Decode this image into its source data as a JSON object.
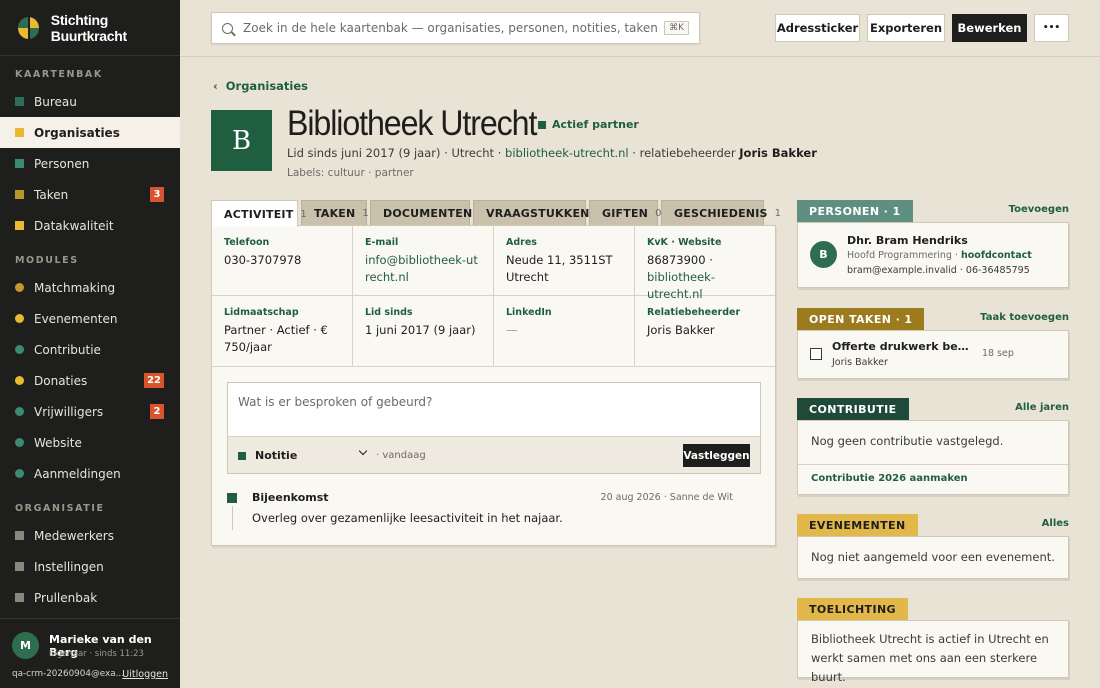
{
  "app": {
    "name": "Stichting Buurtkracht"
  },
  "sidebar": {
    "sections": [
      {
        "title": "KAARTENBAK",
        "items": [
          {
            "label": "Bureau",
            "color": "#2e6e5a",
            "shape": "square"
          },
          {
            "label": "Organisaties",
            "color": "#e8b931",
            "shape": "square",
            "active": true
          },
          {
            "label": "Personen",
            "color": "#3b8a72",
            "shape": "square"
          },
          {
            "label": "Taken",
            "color": "#b8962b",
            "shape": "square",
            "badge": "3"
          },
          {
            "label": "Datakwaliteit",
            "color": "#e8b931",
            "shape": "square"
          }
        ]
      },
      {
        "title": "MODULES",
        "items": [
          {
            "label": "Matchmaking",
            "color": "#c39a2a",
            "shape": "dot"
          },
          {
            "label": "Evenementen",
            "color": "#e8b931",
            "shape": "dot"
          },
          {
            "label": "Contributie",
            "color": "#3b8a72",
            "shape": "dot"
          },
          {
            "label": "Donaties",
            "color": "#e8b931",
            "shape": "dot",
            "badge": "22"
          },
          {
            "label": "Vrijwilligers",
            "color": "#3b8a72",
            "shape": "dot",
            "badge": "2"
          },
          {
            "label": "Website",
            "color": "#3b8a72",
            "shape": "dot"
          },
          {
            "label": "Aanmeldingen",
            "color": "#3b8a72",
            "shape": "dot"
          }
        ]
      },
      {
        "title": "ORGANISATIE",
        "items": [
          {
            "label": "Medewerkers",
            "color": "#8a867d",
            "shape": "square"
          },
          {
            "label": "Instellingen",
            "color": "#8a867d",
            "shape": "square"
          },
          {
            "label": "Prullenbak",
            "color": "#8a867d",
            "shape": "square"
          }
        ]
      }
    ],
    "user": {
      "initial": "M",
      "name": "Marieke van den Berg",
      "role": "Eigenaar · sinds 11:23",
      "email": "qa-crm-20260904@exa...",
      "logout": "Uitloggen"
    }
  },
  "topbar": {
    "search_placeholder": "Zoek in de hele kaartenbak — organisaties, personen, notities, taken, documenten",
    "search_shortcut": "⌘K",
    "buttons": {
      "address": "Adressticker",
      "export": "Exporteren",
      "edit": "Bewerken",
      "more": "•••"
    }
  },
  "header": {
    "breadcrumb": "Organisaties",
    "logo_letter": "B",
    "title": "Bibliotheek Utrecht",
    "status": "Actief partner",
    "meta_prefix": "Lid sinds juni 2017 (9 jaar) · Utrecht · ",
    "meta_site": "bibliotheek-utrecht.nl",
    "meta_manager_label": " · relatiebeheerder ",
    "meta_manager": "Joris Bakker",
    "labels": "Labels: cultuur · partner"
  },
  "tabs": [
    {
      "label": "ACTIVITEIT",
      "count": "1",
      "active": true
    },
    {
      "label": "TAKEN",
      "count": "1"
    },
    {
      "label": "DOCUMENTEN",
      "count": "0"
    },
    {
      "label": "VRAAGSTUKKEN",
      "count": "0"
    },
    {
      "label": "GIFTEN",
      "count": "0"
    },
    {
      "label": "GESCHIEDENIS",
      "count": "1"
    }
  ],
  "details": {
    "phone": {
      "label": "Telefoon",
      "value": "030-3707978"
    },
    "email": {
      "label": "E-mail",
      "value": "info@bibliotheek-utrecht.nl"
    },
    "address": {
      "label": "Adres",
      "value": "Neude 11, 3511ST Utrecht"
    },
    "kvk": {
      "label": "KvK · Website",
      "value": "86873900 ·",
      "site": "bibliotheek-utrecht.nl"
    },
    "membership": {
      "label": "Lidmaatschap",
      "value": "Partner · Actief · € 750/jaar"
    },
    "since": {
      "label": "Lid sinds",
      "value": "1 juni 2017 (9 jaar)"
    },
    "linkedin": {
      "label": "LinkedIn",
      "value": "—"
    },
    "manager": {
      "label": "Relatiebeheerder",
      "value": "Joris Bakker"
    }
  },
  "note": {
    "placeholder": "Wat is er besproken of gebeurd?",
    "type": "Notitie",
    "date": "· vandaag",
    "submit": "Vastleggen"
  },
  "timeline": [
    {
      "title": "Bijeenkomst",
      "meta": "20 aug 2026 · Sanne de Wit",
      "body": "Overleg over gezamenlijke leesactiviteit in het najaar."
    }
  ],
  "right": {
    "persons": {
      "title": "PERSONEN · 1",
      "link": "Toevoegen",
      "color": "#5f8f80",
      "person": {
        "initial": "B",
        "name": "Dhr. Bram Hendriks",
        "role": "Hoofd Programmering · ",
        "role_tag": "hoofdcontact",
        "contact": "bram@example.invalid · 06-36485795"
      }
    },
    "tasks": {
      "title": "OPEN TAKEN · 1",
      "link": "Taak toevoegen",
      "color": "#9c7a1e",
      "task": {
        "title": "Offerte drukwerk beoordelen",
        "who": "Joris Bakker",
        "date": "18 sep"
      }
    },
    "contribution": {
      "title": "CONTRIBUTIE",
      "link": "Alle jaren",
      "color": "#1f4a3a",
      "text": "Nog geen contributie vastgelegd.",
      "action": "Contributie 2026 aanmaken"
    },
    "events": {
      "title": "EVENEMENTEN",
      "link": "Alles",
      "color": "#e3b84a",
      "text": "Nog niet aangemeld voor een evenement."
    },
    "explanation": {
      "title": "TOELICHTING",
      "color": "#e3b84a",
      "text": "Bibliotheek Utrecht is actief in Utrecht en werkt samen met ons aan een sterkere buurt."
    }
  }
}
